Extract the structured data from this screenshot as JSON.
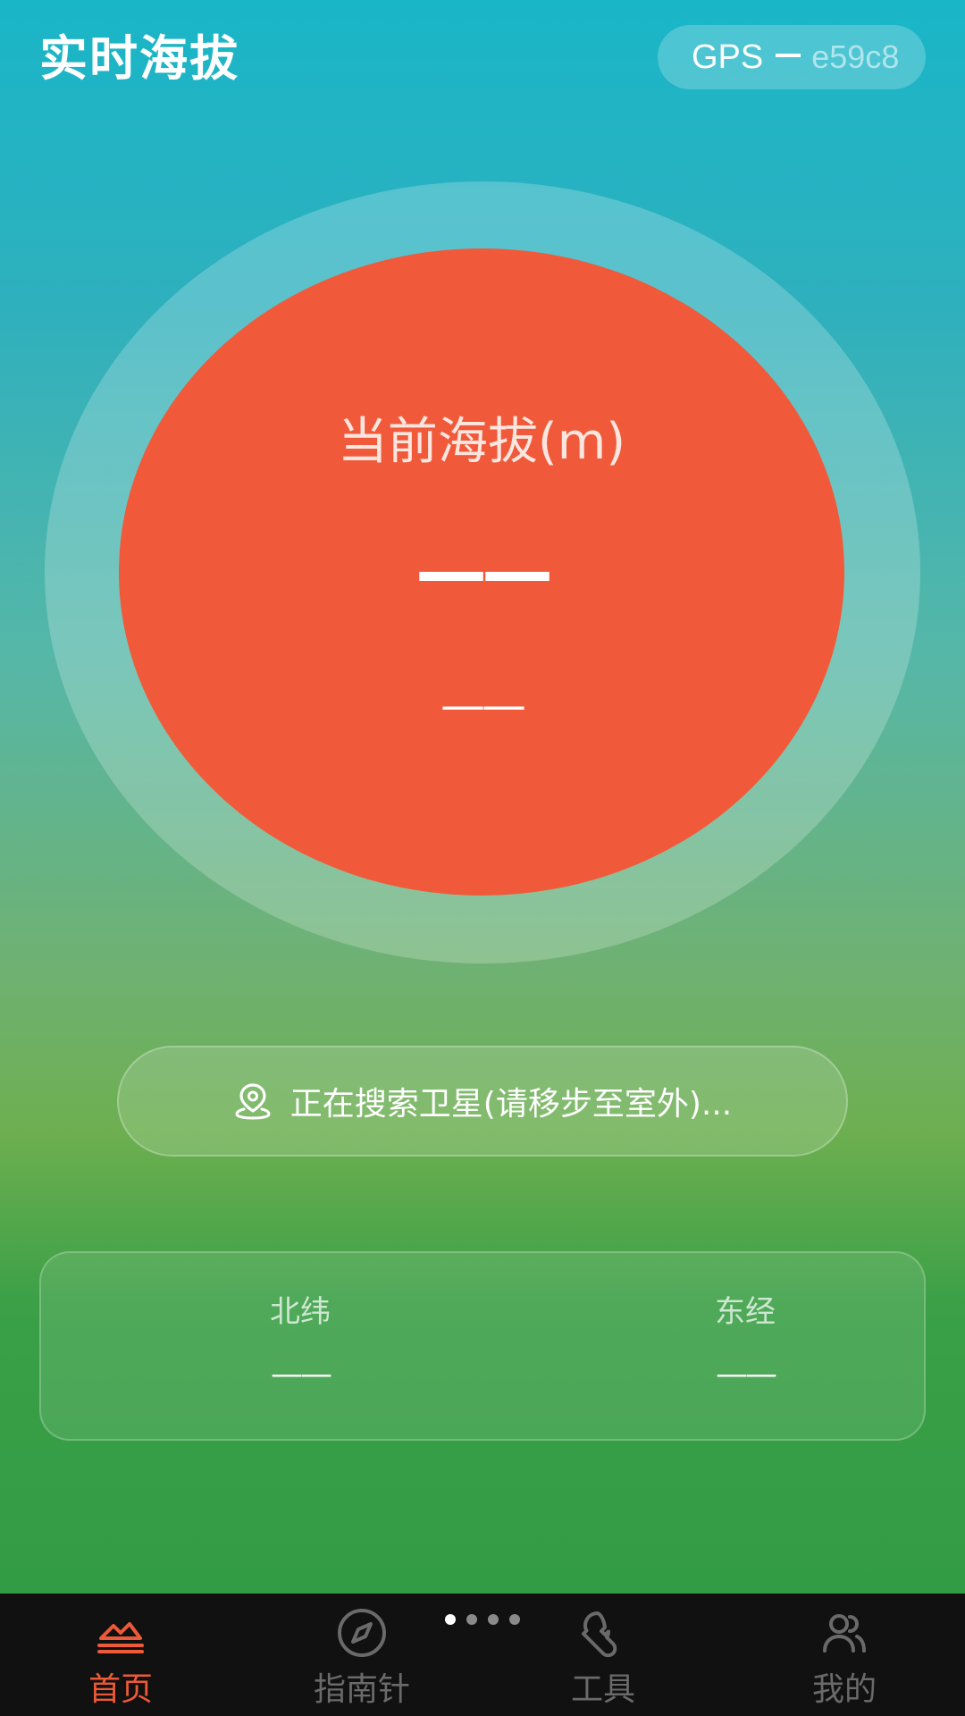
{
  "header": {
    "title": "实时海拔",
    "gps_label": "GPS",
    "gps_code": "e59c8"
  },
  "altitude": {
    "label": "当前海拔(m)",
    "value": "——",
    "sub_value": "——"
  },
  "status": {
    "icon": "location-pin-icon",
    "text": "正在搜索卫星(请移步至室外)..."
  },
  "coordinates": {
    "latitude_label": "北纬",
    "latitude_value": "——",
    "longitude_label": "东经",
    "longitude_value": "——"
  },
  "pager": {
    "count": 4,
    "active_index": 0
  },
  "nav": {
    "items": [
      {
        "label": "首页",
        "icon": "mountain-icon",
        "active": true
      },
      {
        "label": "指南针",
        "icon": "compass-icon",
        "active": false
      },
      {
        "label": "工具",
        "icon": "wrench-icon",
        "active": false
      },
      {
        "label": "我的",
        "icon": "users-icon",
        "active": false
      }
    ]
  },
  "colors": {
    "accent": "#f05a3a",
    "nav_active": "#ec5a38",
    "nav_inactive": "#6a6a6a",
    "nav_background": "#111111"
  }
}
